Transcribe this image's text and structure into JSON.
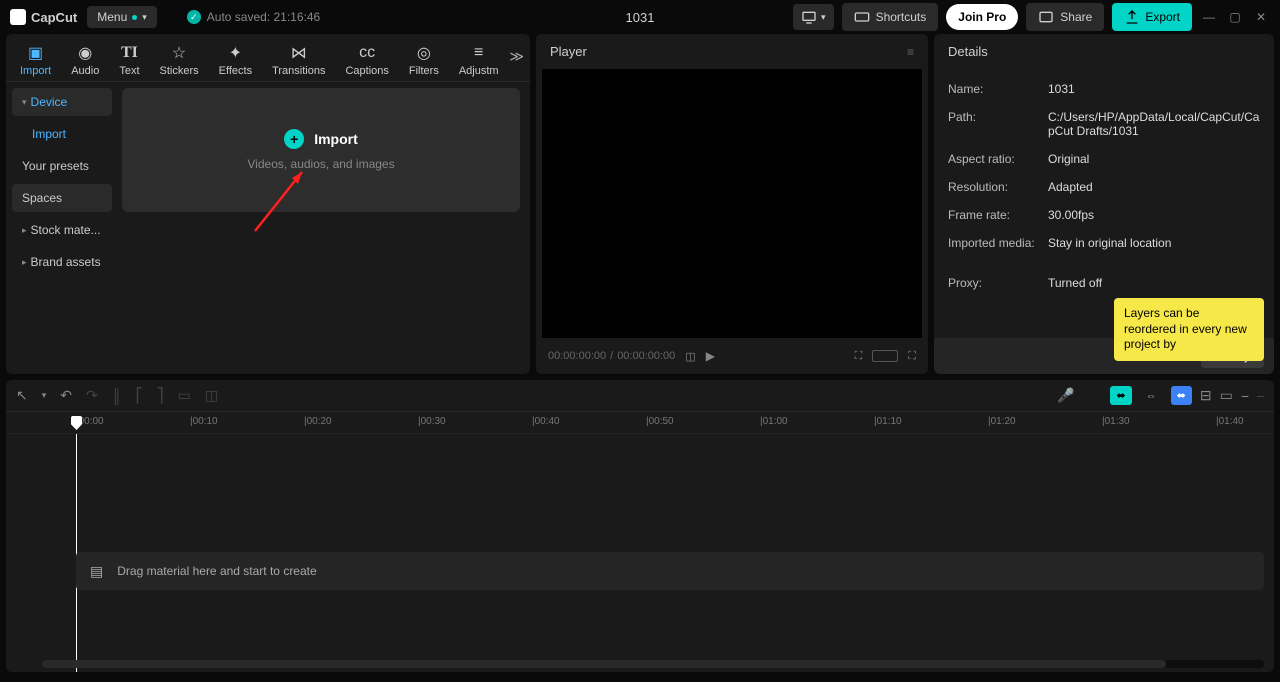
{
  "app": {
    "name": "CapCut",
    "project_title": "1031"
  },
  "topbar": {
    "menu": "Menu",
    "autosave": "Auto saved: 21:16:46",
    "shortcuts": "Shortcuts",
    "join_pro": "Join Pro",
    "share": "Share",
    "export": "Export"
  },
  "media_tabs": [
    {
      "label": "Import"
    },
    {
      "label": "Audio"
    },
    {
      "label": "Text"
    },
    {
      "label": "Stickers"
    },
    {
      "label": "Effects"
    },
    {
      "label": "Transitions"
    },
    {
      "label": "Captions"
    },
    {
      "label": "Filters"
    },
    {
      "label": "Adjustm"
    }
  ],
  "sidebar": {
    "device": "Device",
    "import": "Import",
    "presets": "Your presets",
    "spaces": "Spaces",
    "stock": "Stock mate...",
    "brand": "Brand assets"
  },
  "import_box": {
    "title": "Import",
    "subtitle": "Videos, audios, and images"
  },
  "player": {
    "title": "Player",
    "current": "00:00:00:00",
    "sep": "/",
    "total": "00:00:00:00"
  },
  "details": {
    "title": "Details",
    "rows": {
      "name_l": "Name:",
      "name_v": "1031",
      "path_l": "Path:",
      "path_v": "C:/Users/HP/AppData/Local/CapCut/CapCut Drafts/1031",
      "ratio_l": "Aspect ratio:",
      "ratio_v": "Original",
      "res_l": "Resolution:",
      "res_v": "Adapted",
      "fps_l": "Frame rate:",
      "fps_v": "30.00fps",
      "imp_l": "Imported media:",
      "imp_v": "Stay in original location",
      "proxy_l": "Proxy:",
      "proxy_v": "Turned off"
    },
    "tooltip": "Layers can be reordered in every new project by",
    "modify": "Modify"
  },
  "timeline": {
    "ticks": [
      "|00:00",
      "|00:10",
      "|00:20",
      "|00:30",
      "|00:40",
      "|00:50",
      "|01:00",
      "|01:10",
      "|01:20",
      "|01:30",
      "|01:40"
    ],
    "drop_hint": "Drag material here and start to create"
  }
}
